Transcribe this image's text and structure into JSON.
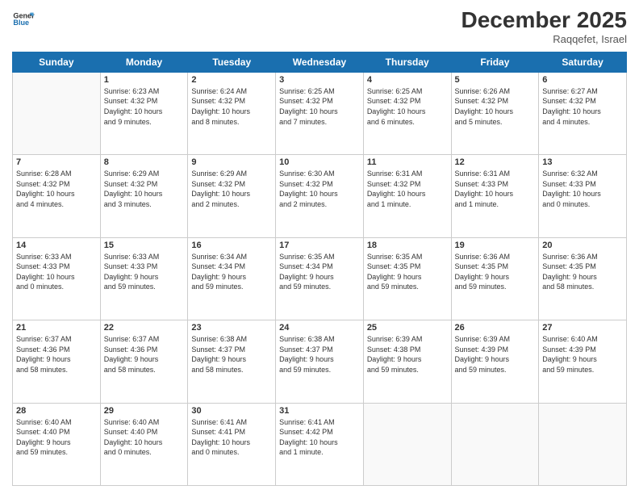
{
  "logo": {
    "line1": "General",
    "line2": "Blue"
  },
  "title": "December 2025",
  "location": "Raqqefet, Israel",
  "days_of_week": [
    "Sunday",
    "Monday",
    "Tuesday",
    "Wednesday",
    "Thursday",
    "Friday",
    "Saturday"
  ],
  "weeks": [
    [
      {
        "day": "",
        "info": ""
      },
      {
        "day": "1",
        "info": "Sunrise: 6:23 AM\nSunset: 4:32 PM\nDaylight: 10 hours\nand 9 minutes."
      },
      {
        "day": "2",
        "info": "Sunrise: 6:24 AM\nSunset: 4:32 PM\nDaylight: 10 hours\nand 8 minutes."
      },
      {
        "day": "3",
        "info": "Sunrise: 6:25 AM\nSunset: 4:32 PM\nDaylight: 10 hours\nand 7 minutes."
      },
      {
        "day": "4",
        "info": "Sunrise: 6:25 AM\nSunset: 4:32 PM\nDaylight: 10 hours\nand 6 minutes."
      },
      {
        "day": "5",
        "info": "Sunrise: 6:26 AM\nSunset: 4:32 PM\nDaylight: 10 hours\nand 5 minutes."
      },
      {
        "day": "6",
        "info": "Sunrise: 6:27 AM\nSunset: 4:32 PM\nDaylight: 10 hours\nand 4 minutes."
      }
    ],
    [
      {
        "day": "7",
        "info": "Sunrise: 6:28 AM\nSunset: 4:32 PM\nDaylight: 10 hours\nand 4 minutes."
      },
      {
        "day": "8",
        "info": "Sunrise: 6:29 AM\nSunset: 4:32 PM\nDaylight: 10 hours\nand 3 minutes."
      },
      {
        "day": "9",
        "info": "Sunrise: 6:29 AM\nSunset: 4:32 PM\nDaylight: 10 hours\nand 2 minutes."
      },
      {
        "day": "10",
        "info": "Sunrise: 6:30 AM\nSunset: 4:32 PM\nDaylight: 10 hours\nand 2 minutes."
      },
      {
        "day": "11",
        "info": "Sunrise: 6:31 AM\nSunset: 4:32 PM\nDaylight: 10 hours\nand 1 minute."
      },
      {
        "day": "12",
        "info": "Sunrise: 6:31 AM\nSunset: 4:33 PM\nDaylight: 10 hours\nand 1 minute."
      },
      {
        "day": "13",
        "info": "Sunrise: 6:32 AM\nSunset: 4:33 PM\nDaylight: 10 hours\nand 0 minutes."
      }
    ],
    [
      {
        "day": "14",
        "info": "Sunrise: 6:33 AM\nSunset: 4:33 PM\nDaylight: 10 hours\nand 0 minutes."
      },
      {
        "day": "15",
        "info": "Sunrise: 6:33 AM\nSunset: 4:33 PM\nDaylight: 9 hours\nand 59 minutes."
      },
      {
        "day": "16",
        "info": "Sunrise: 6:34 AM\nSunset: 4:34 PM\nDaylight: 9 hours\nand 59 minutes."
      },
      {
        "day": "17",
        "info": "Sunrise: 6:35 AM\nSunset: 4:34 PM\nDaylight: 9 hours\nand 59 minutes."
      },
      {
        "day": "18",
        "info": "Sunrise: 6:35 AM\nSunset: 4:35 PM\nDaylight: 9 hours\nand 59 minutes."
      },
      {
        "day": "19",
        "info": "Sunrise: 6:36 AM\nSunset: 4:35 PM\nDaylight: 9 hours\nand 59 minutes."
      },
      {
        "day": "20",
        "info": "Sunrise: 6:36 AM\nSunset: 4:35 PM\nDaylight: 9 hours\nand 58 minutes."
      }
    ],
    [
      {
        "day": "21",
        "info": "Sunrise: 6:37 AM\nSunset: 4:36 PM\nDaylight: 9 hours\nand 58 minutes."
      },
      {
        "day": "22",
        "info": "Sunrise: 6:37 AM\nSunset: 4:36 PM\nDaylight: 9 hours\nand 58 minutes."
      },
      {
        "day": "23",
        "info": "Sunrise: 6:38 AM\nSunset: 4:37 PM\nDaylight: 9 hours\nand 58 minutes."
      },
      {
        "day": "24",
        "info": "Sunrise: 6:38 AM\nSunset: 4:37 PM\nDaylight: 9 hours\nand 59 minutes."
      },
      {
        "day": "25",
        "info": "Sunrise: 6:39 AM\nSunset: 4:38 PM\nDaylight: 9 hours\nand 59 minutes."
      },
      {
        "day": "26",
        "info": "Sunrise: 6:39 AM\nSunset: 4:39 PM\nDaylight: 9 hours\nand 59 minutes."
      },
      {
        "day": "27",
        "info": "Sunrise: 6:40 AM\nSunset: 4:39 PM\nDaylight: 9 hours\nand 59 minutes."
      }
    ],
    [
      {
        "day": "28",
        "info": "Sunrise: 6:40 AM\nSunset: 4:40 PM\nDaylight: 9 hours\nand 59 minutes."
      },
      {
        "day": "29",
        "info": "Sunrise: 6:40 AM\nSunset: 4:40 PM\nDaylight: 10 hours\nand 0 minutes."
      },
      {
        "day": "30",
        "info": "Sunrise: 6:41 AM\nSunset: 4:41 PM\nDaylight: 10 hours\nand 0 minutes."
      },
      {
        "day": "31",
        "info": "Sunrise: 6:41 AM\nSunset: 4:42 PM\nDaylight: 10 hours\nand 1 minute."
      },
      {
        "day": "",
        "info": ""
      },
      {
        "day": "",
        "info": ""
      },
      {
        "day": "",
        "info": ""
      }
    ]
  ]
}
